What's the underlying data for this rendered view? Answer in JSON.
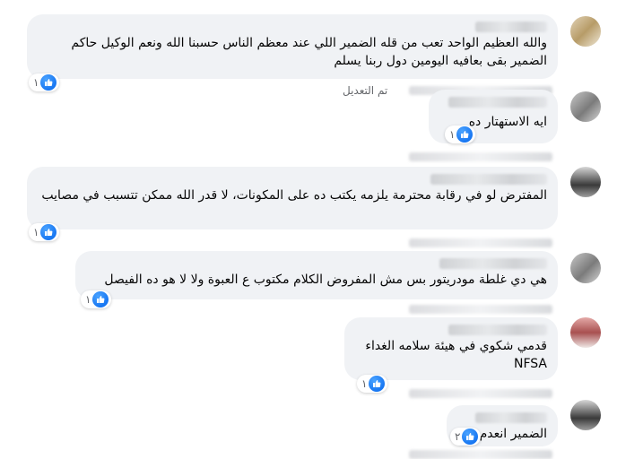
{
  "comments": [
    {
      "text": "والله العظيم الواحد تعب من قله الضمير اللي عند معظم الناس حسبنا الله ونعم الوكيل حاكم الضمير بقى بعافيه اليومين دول ربنا يسلم",
      "reactions": "١",
      "edited_label": "تم التعديل"
    },
    {
      "text": "ايه الاستهتار ده",
      "reactions": "١"
    },
    {
      "text": "المفترض لو في رقابة محترمة يلزمه يكتب ده على المكونات، لا قدر الله ممكن تتسبب في مصايب",
      "reactions": "١"
    },
    {
      "text": "هي دي غلطة مودريتور بس مش المفروض الكلام مكتوب ع العبوة ولا لا هو ده الفيصل",
      "reactions": "١"
    },
    {
      "text": "قدمي شكوي في هيئة سلامه الغداء NFSA",
      "reactions": "١"
    },
    {
      "text": "الضمير انعدم",
      "reactions": "٢"
    }
  ],
  "colors": {
    "bubble": "#f0f2f5",
    "like": "#1877f2",
    "meta": "#65676b"
  },
  "icons": {
    "reaction": "like-icon"
  }
}
